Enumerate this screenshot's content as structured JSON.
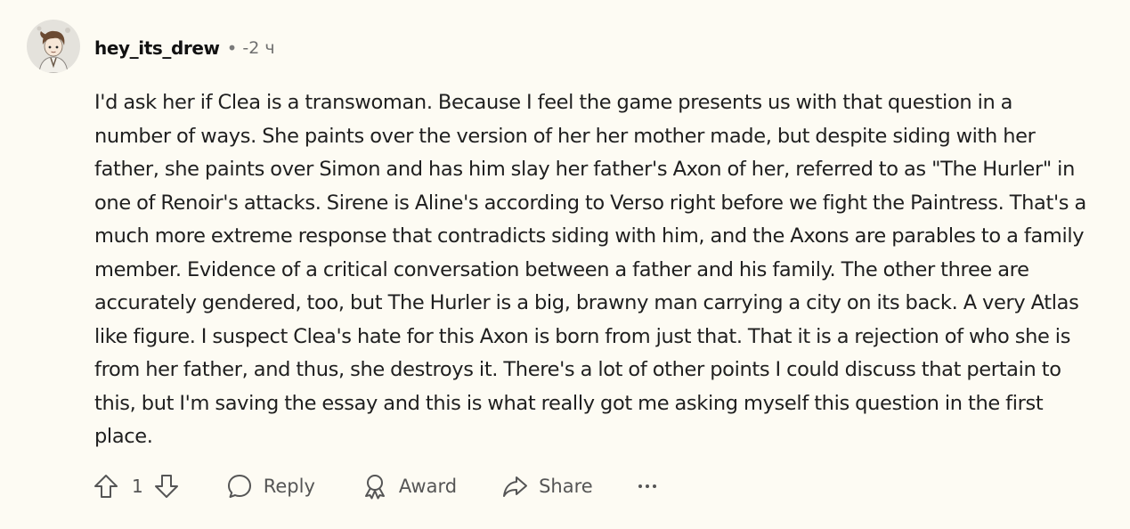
{
  "comment": {
    "author": "hey_its_drew",
    "separator": "•",
    "time": "-2 ч",
    "text": "I'd ask her if Clea is a transwoman. Because I feel the game presents us with that question in a number of ways. She paints over the version of her her mother made, but despite siding with her father, she paints over Simon and has him slay her father's Axon of her, referred to as \"The Hurler\" in one of Renoir's attacks. Sirene is Aline's according to Verso right before we fight the Paintress. That's a much more extreme response that contradicts siding with him, and the Axons are parables to a family member. Evidence of a critical conversation between a father and his family. The other three are accurately gendered, too, but The Hurler is a big, brawny man carrying a city on its back. A very Atlas like figure. I suspect Clea's hate for this Axon is born from just that. That it is a rejection of who she is from her father, and thus, she destroys it. There's a lot of other points I could discuss that pertain to this, but I'm saving the essay and this is what really got me asking myself this question in the first place."
  },
  "actions": {
    "vote_count": "1",
    "reply_label": "Reply",
    "award_label": "Award",
    "share_label": "Share",
    "more_label": "•••"
  },
  "icons": {
    "upvote": "arrow-up-icon",
    "downvote": "arrow-down-icon",
    "reply": "speech-bubble-icon",
    "award": "award-ribbon-icon",
    "share": "share-arrow-icon",
    "more": "ellipsis-icon"
  },
  "colors": {
    "background": "#fdfbf3",
    "text": "#1f1f1f",
    "muted": "#555555"
  }
}
